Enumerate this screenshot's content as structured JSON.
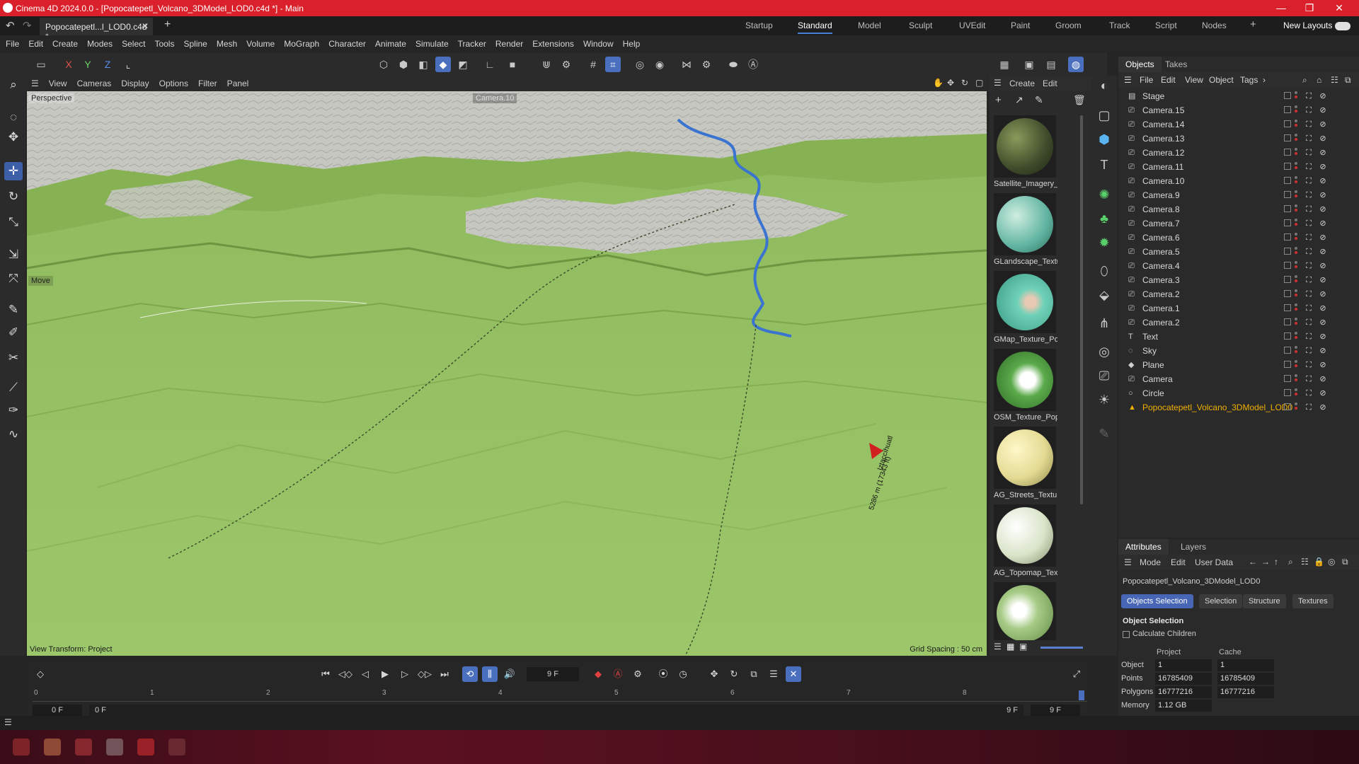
{
  "window": {
    "title": "Cinema 4D 2024.0.0 - [Popocatepetl_Volcano_3DModel_LOD0.c4d *] - Main",
    "controls": [
      "minimize-icon",
      "restore-icon",
      "close-icon"
    ]
  },
  "tabs": {
    "document": "Popocatepetl...l_LOD0.c4d *",
    "layouts": [
      "Startup",
      "Standard",
      "Model",
      "Sculpt",
      "UVEdit",
      "Paint",
      "Groom",
      "Track",
      "Script",
      "Nodes"
    ],
    "active_layout": "Standard",
    "new_layouts": "New Layouts"
  },
  "menu": [
    "File",
    "Edit",
    "Create",
    "Modes",
    "Select",
    "Tools",
    "Spline",
    "Mesh",
    "Volume",
    "MoGraph",
    "Character",
    "Animate",
    "Simulate",
    "Tracker",
    "Render",
    "Extensions",
    "Window",
    "Help"
  ],
  "toolbar": {
    "axis_x": "X",
    "axis_y": "Y",
    "axis_z": "Z"
  },
  "viewport": {
    "menu": [
      "View",
      "Cameras",
      "Display",
      "Options",
      "Filter",
      "Panel"
    ],
    "projection": "Perspective",
    "camera": "Camera.10",
    "tool": "Move",
    "transform": "View Transform: Project",
    "grid_spacing": "Grid Spacing : 50 cm",
    "marker_label_1": "Iztaccíhuatl",
    "marker_label_2": "5286 m (17343 ft)"
  },
  "materials": {
    "menu": [
      "Create",
      "Edit"
    ],
    "items": [
      {
        "name": "Satellite_Imagery_",
        "color": "#3e4a2a"
      },
      {
        "name": "GLandscape_Textu",
        "color": "#5fb3a0"
      },
      {
        "name": "GMap_Texture_Po",
        "color": "#6fd1b8"
      },
      {
        "name": "OSM_Texture_Pop",
        "color": "#5aaa4a"
      },
      {
        "name": "AG_Streets_Textur",
        "color": "#e3db93"
      },
      {
        "name": "AG_Topomap_Tex",
        "color": "#d9e4c8"
      },
      {
        "name": "",
        "color": "#a8cc88"
      }
    ]
  },
  "objects_panel": {
    "tabs": [
      "Objects",
      "Takes"
    ],
    "menu": [
      "File",
      "Edit",
      "View",
      "Object",
      "Tags"
    ],
    "rows": [
      {
        "name": "Stage",
        "icon": "stage-icon"
      },
      {
        "name": "Camera.15",
        "icon": "camera-icon"
      },
      {
        "name": "Camera.14",
        "icon": "camera-icon"
      },
      {
        "name": "Camera.13",
        "icon": "camera-icon"
      },
      {
        "name": "Camera.12",
        "icon": "camera-icon"
      },
      {
        "name": "Camera.11",
        "icon": "camera-icon"
      },
      {
        "name": "Camera.10",
        "icon": "camera-icon"
      },
      {
        "name": "Camera.9",
        "icon": "camera-icon"
      },
      {
        "name": "Camera.8",
        "icon": "camera-icon"
      },
      {
        "name": "Camera.7",
        "icon": "camera-icon"
      },
      {
        "name": "Camera.6",
        "icon": "camera-icon"
      },
      {
        "name": "Camera.5",
        "icon": "camera-icon"
      },
      {
        "name": "Camera.4",
        "icon": "camera-icon"
      },
      {
        "name": "Camera.3",
        "icon": "camera-icon"
      },
      {
        "name": "Camera.2",
        "icon": "camera-icon"
      },
      {
        "name": "Camera.1",
        "icon": "camera-icon"
      },
      {
        "name": "Camera.2",
        "icon": "camera-icon"
      },
      {
        "name": "Text",
        "icon": "text-icon"
      },
      {
        "name": "Sky",
        "icon": "sky-icon"
      },
      {
        "name": "Plane",
        "icon": "plane-icon"
      },
      {
        "name": "Camera",
        "icon": "camera-icon"
      },
      {
        "name": "Circle",
        "icon": "circle-icon"
      },
      {
        "name": "Popocatepetl_Volcano_3DModel_LOD0",
        "icon": "polygon-object-icon",
        "highlight": "#f0b000"
      }
    ]
  },
  "attributes": {
    "tabs": [
      "Attributes",
      "Layers"
    ],
    "menu": [
      "Mode",
      "Edit",
      "User Data"
    ],
    "object_name": "Popocatepetl_Volcano_3DModel_LOD0",
    "subtabs": [
      "Objects Selection",
      "Selection",
      "Structure",
      "Textures"
    ],
    "section_title": "Object Selection",
    "calculate_children": "Calculate Children",
    "col_project": "Project",
    "col_cache": "Cache",
    "stats": [
      {
        "label": "Object",
        "project": "1",
        "cache": "1"
      },
      {
        "label": "Points",
        "project": "16785409",
        "cache": "16785409"
      },
      {
        "label": "Polygons",
        "project": "16777216",
        "cache": "16777216"
      },
      {
        "label": "Memory",
        "project": "1.12 GB",
        "cache": ""
      }
    ]
  },
  "timeline": {
    "current_frame": "9 F",
    "ruler_ticks": [
      "0",
      "1",
      "2",
      "3",
      "4",
      "5",
      "6",
      "7",
      "8"
    ],
    "start": "0 F",
    "range_start": "0 F",
    "range_end": "9 F",
    "end": "9 F"
  },
  "colors": {
    "titlebar": "#d9202b",
    "accent": "#4a6fbf",
    "terrain": "#8db85c",
    "river": "#3a74d0"
  }
}
